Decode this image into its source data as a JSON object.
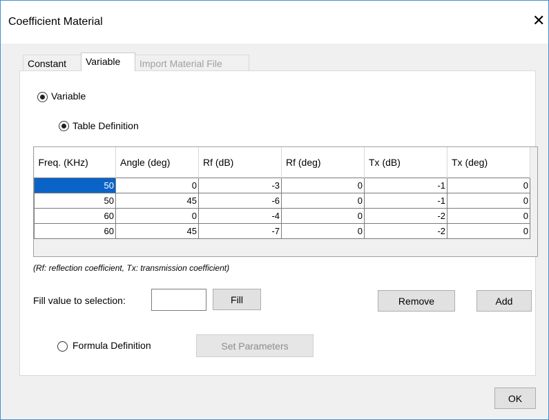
{
  "window": {
    "title": "Coefficient Material",
    "close_glyph": "✕"
  },
  "tabs": [
    {
      "label": "Constant",
      "state": "normal"
    },
    {
      "label": "Variable",
      "state": "active"
    },
    {
      "label": "Import Material File",
      "state": "disabled"
    }
  ],
  "panel": {
    "variable_radio_label": "Variable",
    "table_definition_label": "Table Definition",
    "table": {
      "columns": [
        "Freq. (KHz)",
        "Angle (deg)",
        "Rf (dB)",
        "Rf (deg)",
        "Tx (dB)",
        "Tx (deg)"
      ],
      "rows": [
        [
          "50",
          "0",
          "-3",
          "0",
          "-1",
          "0"
        ],
        [
          "50",
          "45",
          "-6",
          "0",
          "-1",
          "0"
        ],
        [
          "60",
          "0",
          "-4",
          "0",
          "-2",
          "0"
        ],
        [
          "60",
          "45",
          "-7",
          "0",
          "-2",
          "0"
        ]
      ],
      "selected_cell": [
        0,
        0
      ]
    },
    "note": "(Rf: reflection coefficient, Tx: transmission coefficient)",
    "fill_label": "Fill value to selection:",
    "fill_value": "",
    "fill_button": "Fill",
    "remove_button": "Remove",
    "add_button": "Add",
    "formula_definition_label": "Formula Definition",
    "set_parameters_button": "Set Parameters"
  },
  "ok_button": "OK",
  "colors": {
    "accent": "#0a64c8",
    "window_border": "#3f8fd2"
  }
}
